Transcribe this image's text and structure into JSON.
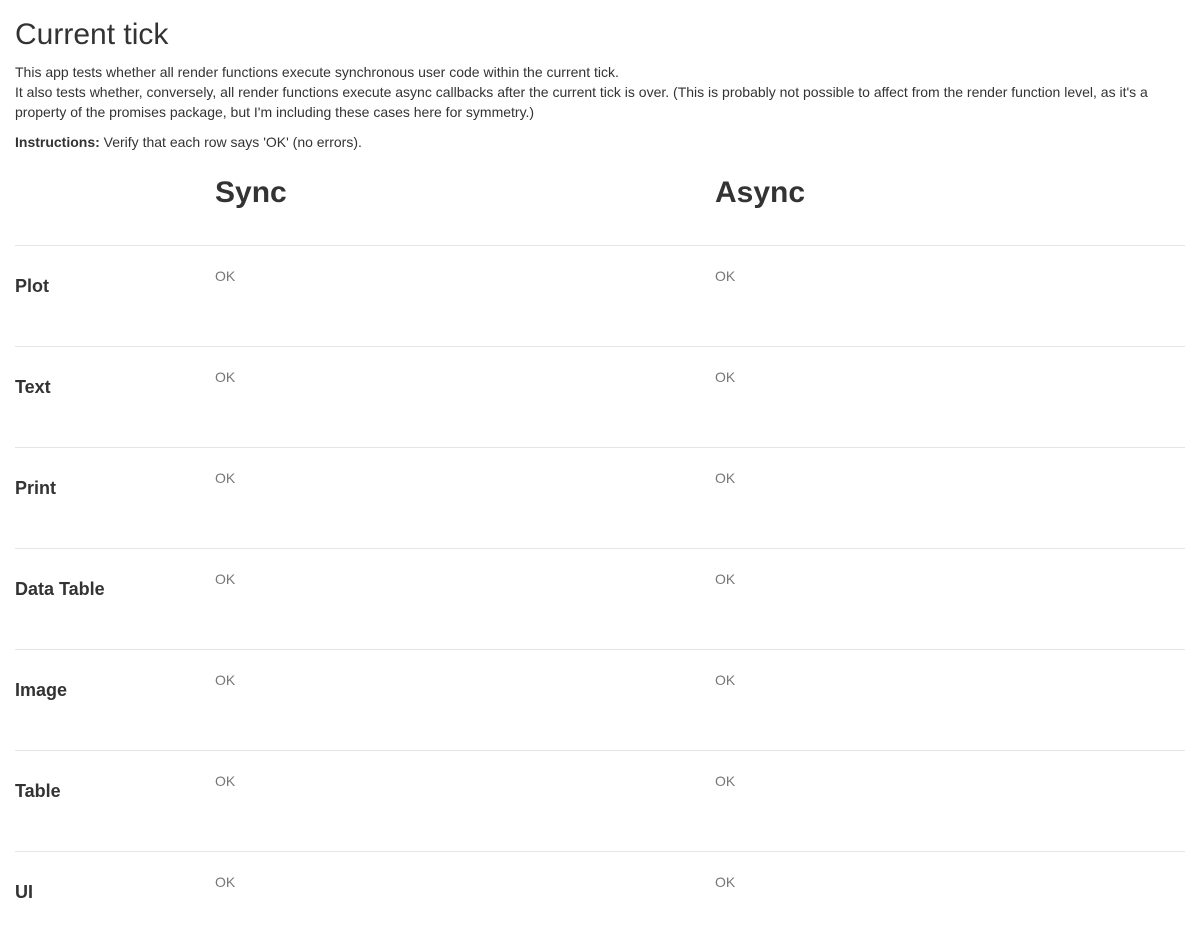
{
  "title": "Current tick",
  "description": {
    "line1": "This app tests whether all render functions execute synchronous user code within the current tick.",
    "line2": "It also tests whether, conversely, all render functions execute async callbacks after the current tick is over. (This is probably not possible to affect from the render function level, as it's a property of the promises package, but I'm including these cases here for symmetry.)"
  },
  "instructions": {
    "label": "Instructions:",
    "text": " Verify that each row says 'OK' (no errors)."
  },
  "columns": {
    "sync": "Sync",
    "async": "Async"
  },
  "rows": [
    {
      "label": "Plot",
      "sync": "OK",
      "async": "OK"
    },
    {
      "label": "Text",
      "sync": "OK",
      "async": "OK"
    },
    {
      "label": "Print",
      "sync": "OK",
      "async": "OK"
    },
    {
      "label": "Data Table",
      "sync": "OK",
      "async": "OK"
    },
    {
      "label": "Image",
      "sync": "OK",
      "async": "OK"
    },
    {
      "label": "Table",
      "sync": "OK",
      "async": "OK"
    },
    {
      "label": "UI",
      "sync": "OK",
      "async": "OK"
    }
  ]
}
